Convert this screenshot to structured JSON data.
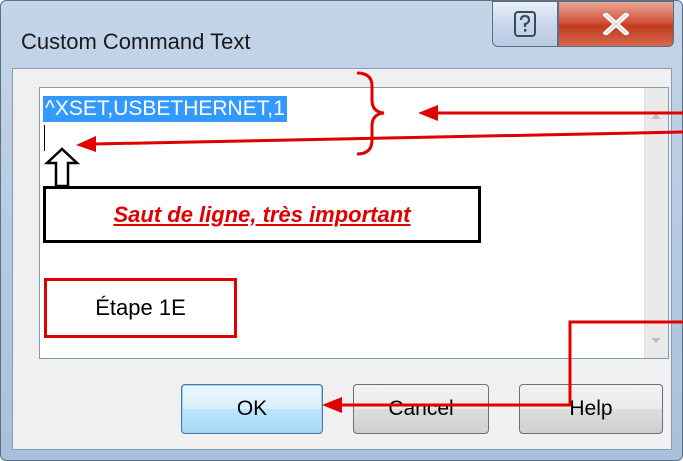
{
  "window": {
    "title": "Custom Command Text",
    "caption_buttons": [
      "help-icon",
      "close-icon"
    ]
  },
  "editor": {
    "selected_text": "^XSET,USBETHERNET,1"
  },
  "annotations": {
    "note": "Saut de ligne, très important",
    "step": "Étape 1E",
    "accent_color": "#e00000"
  },
  "buttons": {
    "ok": "OK",
    "cancel": "Cancel",
    "help": "Help"
  }
}
